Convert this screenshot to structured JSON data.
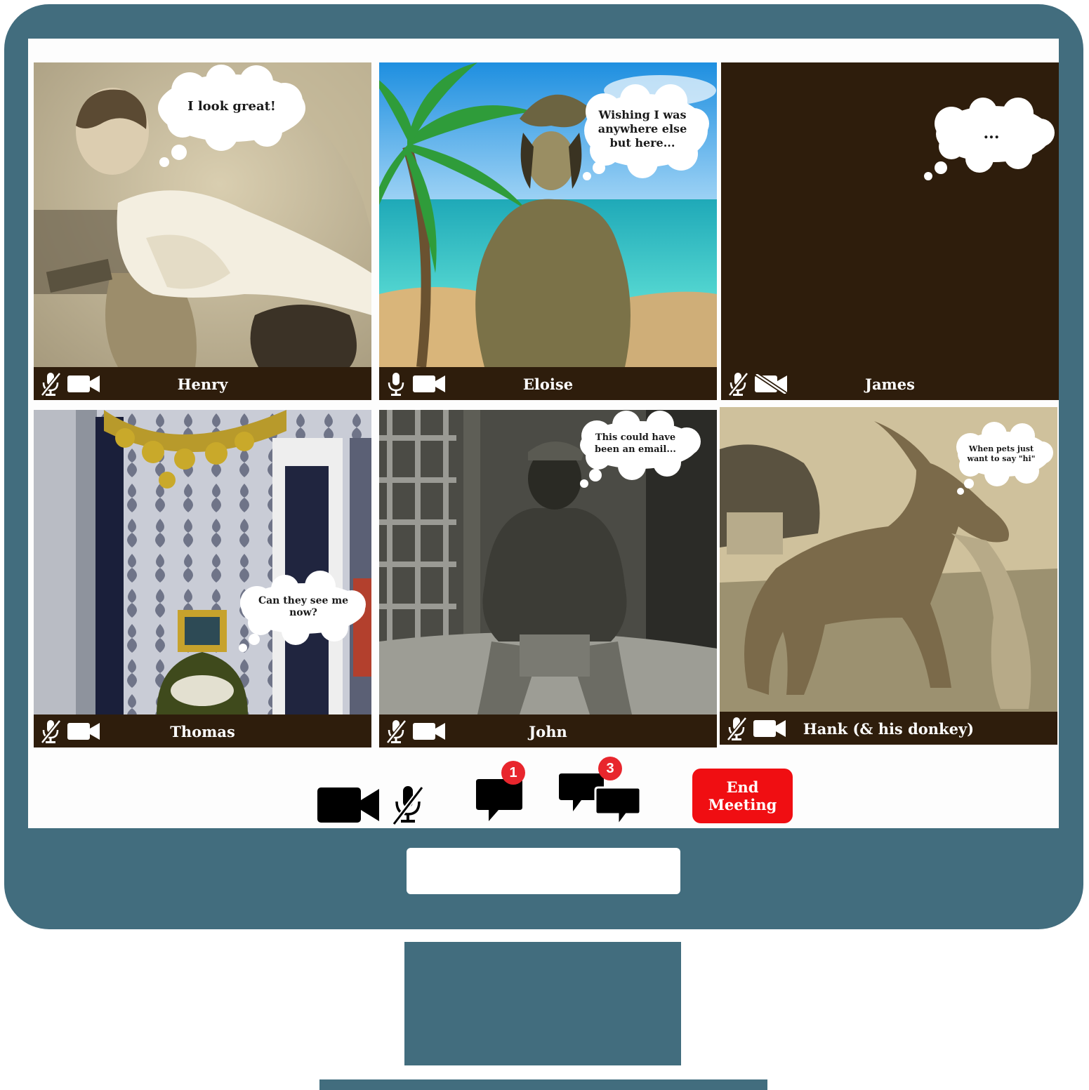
{
  "colors": {
    "monitor": "#426d7e",
    "tile_bar": "#2e1d0c",
    "end_button": "#f00e12",
    "badge": "#e8262d"
  },
  "participants": [
    {
      "name": "Henry",
      "thought": "I look great!",
      "mic": "muted",
      "camera": "on",
      "scene": "sepia-child-portrait"
    },
    {
      "name": "Eloise",
      "thought": "Wishing I was anywhere else but here...",
      "mic": "on",
      "camera": "on",
      "scene": "woman-on-tropical-beach"
    },
    {
      "name": "James",
      "thought": "...",
      "mic": "muted",
      "camera": "off",
      "scene": "blank-dark"
    },
    {
      "name": "Thomas",
      "thought": "Can they see me now?",
      "mic": "muted",
      "camera": "on",
      "scene": "victorian-room-top-hat"
    },
    {
      "name": "John",
      "thought": "This could have been an email...",
      "mic": "muted",
      "camera": "on",
      "scene": "man-seated-outdoors"
    },
    {
      "name": "Hank (& his donkey)",
      "thought": "When pets just want to say \"hi\"",
      "mic": "muted",
      "camera": "on",
      "scene": "donkey-rearing"
    }
  ],
  "toolbar": {
    "camera_icon": "video-camera-icon",
    "mic_icon": "microphone-muted-icon",
    "chat_icon": "chat-bubble-icon",
    "chat_badge": "1",
    "group_chat_icon": "group-chat-icon",
    "group_chat_badge": "3",
    "end_label": "End Meeting"
  }
}
